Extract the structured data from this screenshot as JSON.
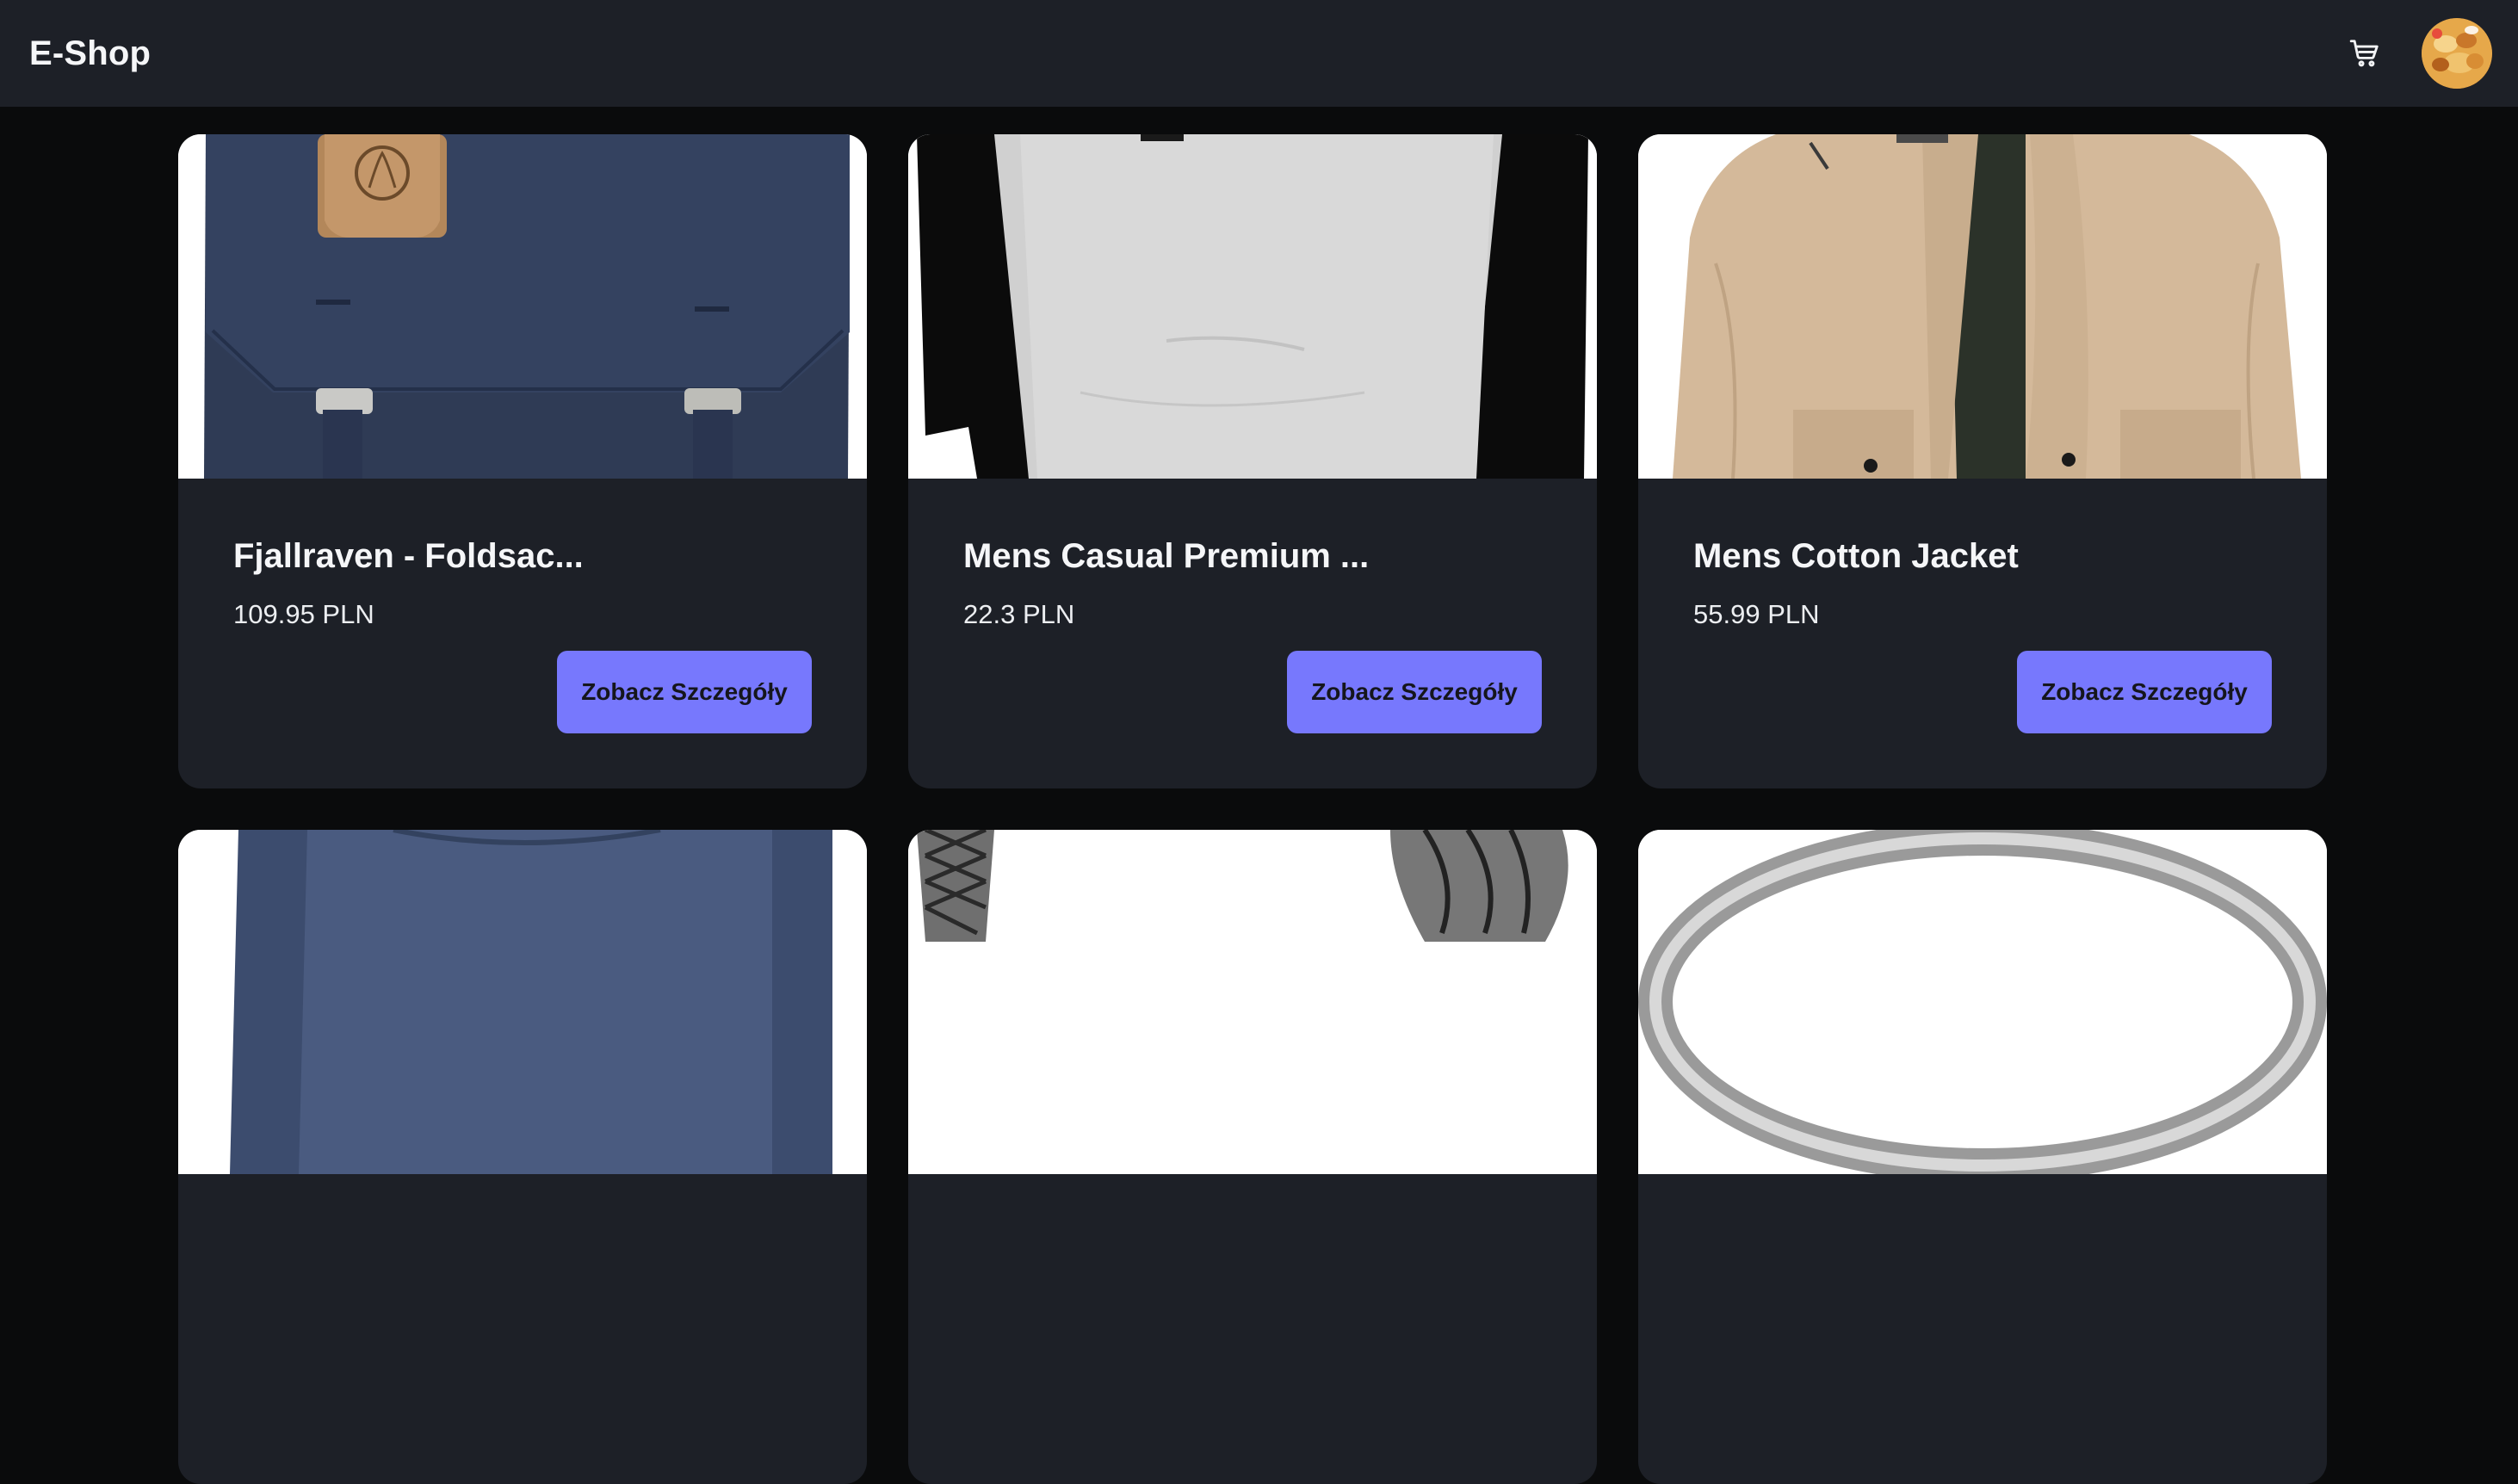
{
  "header": {
    "brand": "E-Shop",
    "cart_icon": "cart-icon",
    "avatar_alt": "user-avatar"
  },
  "products": [
    {
      "title": "Fjallraven - Foldsac...",
      "price": "109.95 PLN",
      "button_label": "Zobacz Szczegóły",
      "image": "backpack"
    },
    {
      "title": "Mens Casual Premium ...",
      "price": "22.3 PLN",
      "button_label": "Zobacz Szczegóły",
      "image": "raglan-tshirt"
    },
    {
      "title": "Mens Cotton Jacket",
      "price": "55.99 PLN",
      "button_label": "Zobacz Szczegóły",
      "image": "jacket"
    },
    {
      "image": "blue-tshirt"
    },
    {
      "image": "chain-bracelet"
    },
    {
      "image": "silver-ring"
    }
  ],
  "colors": {
    "navbar_bg": "#1d2027",
    "page_bg": "#0a0b0c",
    "card_bg": "#1d2027",
    "button_bg": "#7778fd",
    "button_text": "#15161c"
  }
}
